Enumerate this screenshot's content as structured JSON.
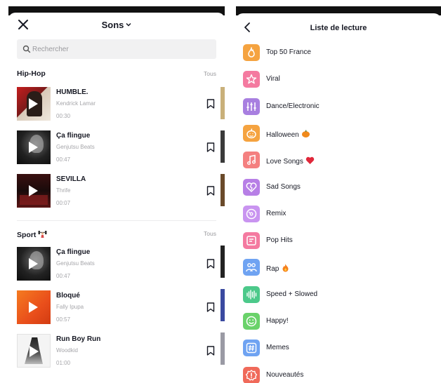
{
  "left": {
    "title": "Sons",
    "search": {
      "placeholder": "Rechercher"
    },
    "sections": [
      {
        "title": "Hip-Hop",
        "see_all": "Tous",
        "tracks": [
          {
            "title": "HUMBLE.",
            "artist": "Kendrick Lamar",
            "duration": "00:30"
          },
          {
            "title": "Ça flingue",
            "artist": "Genjutsu Beats",
            "duration": "00:47"
          },
          {
            "title": "SEVILLA",
            "artist": "Thrife",
            "duration": "00:07"
          }
        ]
      },
      {
        "title": "Sport",
        "see_all": "Tous",
        "tracks": [
          {
            "title": "Ça flingue",
            "artist": "Genjutsu Beats",
            "duration": "00:47"
          },
          {
            "title": "Bloqué",
            "artist": "Fally Ipupa",
            "duration": "00:57"
          },
          {
            "title": "Run Boy Run",
            "artist": "Woodkid",
            "duration": "01:00"
          }
        ]
      }
    ]
  },
  "right": {
    "title": "Liste de lecture",
    "playlists": [
      {
        "label": "Top 50 France",
        "icon": "flame-icon",
        "color": "#f5a340"
      },
      {
        "label": "Viral",
        "icon": "star-icon",
        "color": "#f47aa0"
      },
      {
        "label": "Dance/Electronic",
        "icon": "equalizer-icon",
        "color": "#a87fe0"
      },
      {
        "label": "Halloween",
        "icon": "pumpkin-icon",
        "color": "#f5a340"
      },
      {
        "label": "Love Songs",
        "icon": "music-note-icon",
        "color": "#f48080"
      },
      {
        "label": "Sad Songs",
        "icon": "broken-heart-icon",
        "color": "#b77fe6"
      },
      {
        "label": "Remix",
        "icon": "disc-icon",
        "color": "#c994f0"
      },
      {
        "label": "Pop Hits",
        "icon": "pop-icon",
        "color": "#f47aa0"
      },
      {
        "label": "Rap",
        "icon": "people-icon",
        "color": "#6fa3f2"
      },
      {
        "label": "Speed + Slowed",
        "icon": "waveform-icon",
        "color": "#4cc98a"
      },
      {
        "label": "Happy!",
        "icon": "smile-icon",
        "color": "#6ad26a"
      },
      {
        "label": "Memes",
        "icon": "hashtag-icon",
        "color": "#6fa3f2"
      },
      {
        "label": "Nouveautés",
        "icon": "badge-icon",
        "color": "#f06a5a"
      }
    ]
  }
}
